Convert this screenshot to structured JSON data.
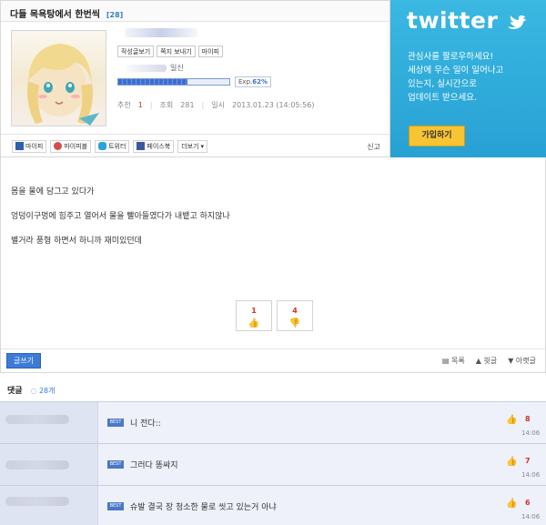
{
  "post": {
    "title": "다들 목욕탕에서 한번씩",
    "reply_count": "[28]",
    "action_buttons": [
      "작성글보기",
      "쪽지 보내기",
      "마이피"
    ],
    "level_text": "일신",
    "exp": {
      "label": "Exp.",
      "percent": "62%",
      "fraction": 0.62
    },
    "stats": {
      "recommend_label": "추천",
      "recommend_value": "1",
      "views_label": "조회",
      "views_value": "281",
      "date_label": "일시",
      "date_value": "2013.01.23 (14:05:56)"
    }
  },
  "share": {
    "items": [
      {
        "label": "마이피",
        "icon": "mypi-icon",
        "color": "#2e5fb0"
      },
      {
        "label": "마이피블",
        "icon": "mypiple-icon",
        "color": "#d84a4a"
      },
      {
        "label": "트위터",
        "icon": "twitter-bird-icon",
        "color": "#2aa3d8"
      },
      {
        "label": "페이스북",
        "icon": "facebook-icon",
        "color": "#3b5998"
      }
    ],
    "more_label": "더보기",
    "report_label": "신고"
  },
  "twitter": {
    "logo": "twitter",
    "message_lines": [
      "관심사를 팔로우하세요!",
      "세상에 무슨 일이 일어나고",
      "있는지, 실시간으로",
      "업데이트 받으세요."
    ],
    "join_label": "가입하기",
    "bg_color": "#2fa9da"
  },
  "body": {
    "lines": [
      "몸을 물에 담그고 있다가",
      "엉덩이구멍에 힘주고 열어서 물을 빨아들였다가 내뱉고 하지않나",
      "별거라 풍형 하면서 하니까 재미있던데"
    ]
  },
  "votes": {
    "up": "1",
    "down": "4"
  },
  "toolbar": {
    "write_label": "글쓰기",
    "list_label": "목록",
    "up_label": "윗글",
    "down_label": "아랫글"
  },
  "comments": {
    "header": "댓글",
    "count": "28개",
    "best_tag": "BEST",
    "items": [
      {
        "text": "니 전다::",
        "score": "8",
        "time": "14:06"
      },
      {
        "text": "그러다 똥싸지",
        "score": "7",
        "time": "14:06"
      },
      {
        "text": "슈발 결국 장 청소한 물로 씻고 있는거 아냐",
        "score": "6",
        "time": "14:06"
      }
    ]
  },
  "colors": {
    "accent_blue": "#3e7bd6",
    "score_red": "#d43030",
    "twitter_blue": "#2fa9da",
    "join_yellow": "#f7c433",
    "comment_bg": "#eef1f9"
  }
}
